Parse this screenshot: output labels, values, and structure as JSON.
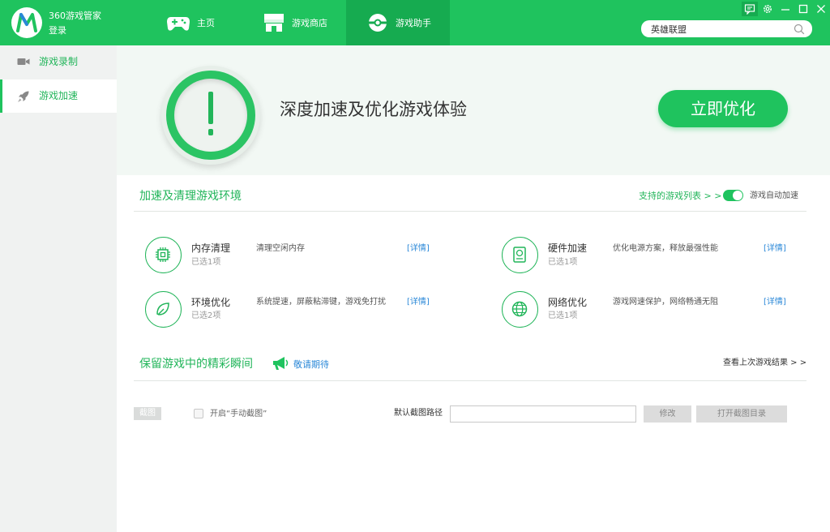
{
  "app": {
    "title": "360游戏管家",
    "login_label": "登录"
  },
  "nav": {
    "tabs": [
      {
        "label": "主页",
        "icon": "gamepad-icon"
      },
      {
        "label": "游戏商店",
        "icon": "store-icon"
      },
      {
        "label": "游戏助手",
        "icon": "pokeball-icon",
        "active": true
      }
    ]
  },
  "window_controls": [
    "feedback-icon",
    "gear-icon",
    "minimize-icon",
    "maximize-icon",
    "close-icon"
  ],
  "search": {
    "value": "英雄联盟",
    "icon": "search-icon"
  },
  "sidebar": {
    "items": [
      {
        "label": "游戏录制",
        "icon": "video-camera-icon"
      },
      {
        "label": "游戏加速",
        "icon": "rocket-icon",
        "active": true
      }
    ]
  },
  "hero": {
    "headline": "深度加速及优化游戏体验",
    "button_label": "立即优化",
    "badge_icon": "exclamation-icon"
  },
  "accelerate": {
    "title": "加速及清理游戏环境",
    "supported_link": "支持的游戏列表 > >",
    "auto_accel_label": "游戏自动加速",
    "auto_accel_on": true,
    "features": [
      {
        "name": "内存清理",
        "sub": "已选1项",
        "desc": "清理空闲内存",
        "detail": "[详情]",
        "icon": "chip-icon"
      },
      {
        "name": "硬件加速",
        "sub": "已选1项",
        "desc": "优化电源方案，释放最强性能",
        "detail": "[详情]",
        "icon": "hard-drive-icon"
      },
      {
        "name": "环境优化",
        "sub": "已选2项",
        "desc": "系统提速，屏蔽粘滞键，游戏免打扰",
        "detail": "[详情]",
        "icon": "leaf-icon"
      },
      {
        "name": "网络优化",
        "sub": "已选1项",
        "desc": "游戏网速保护，网络畅通无阻",
        "detail": "[详情]",
        "icon": "globe-icon"
      }
    ]
  },
  "capture": {
    "title": "保留游戏中的精彩瞬间",
    "coming_soon": "敬请期待",
    "last_result_link": "查看上次游戏结果 > >",
    "tag": "截图",
    "checkbox_label": "开启“手动截图”",
    "checkbox_checked": false,
    "path_label": "默认截图路径",
    "path_value": "",
    "modify_label": "修改",
    "open_dir_label": "打开截图目录"
  },
  "colors": {
    "brand_green": "#1fc35e",
    "active_tab": "#16ab50",
    "link_blue": "#2b88d8",
    "sidebar_bg": "#f0f2f1"
  }
}
